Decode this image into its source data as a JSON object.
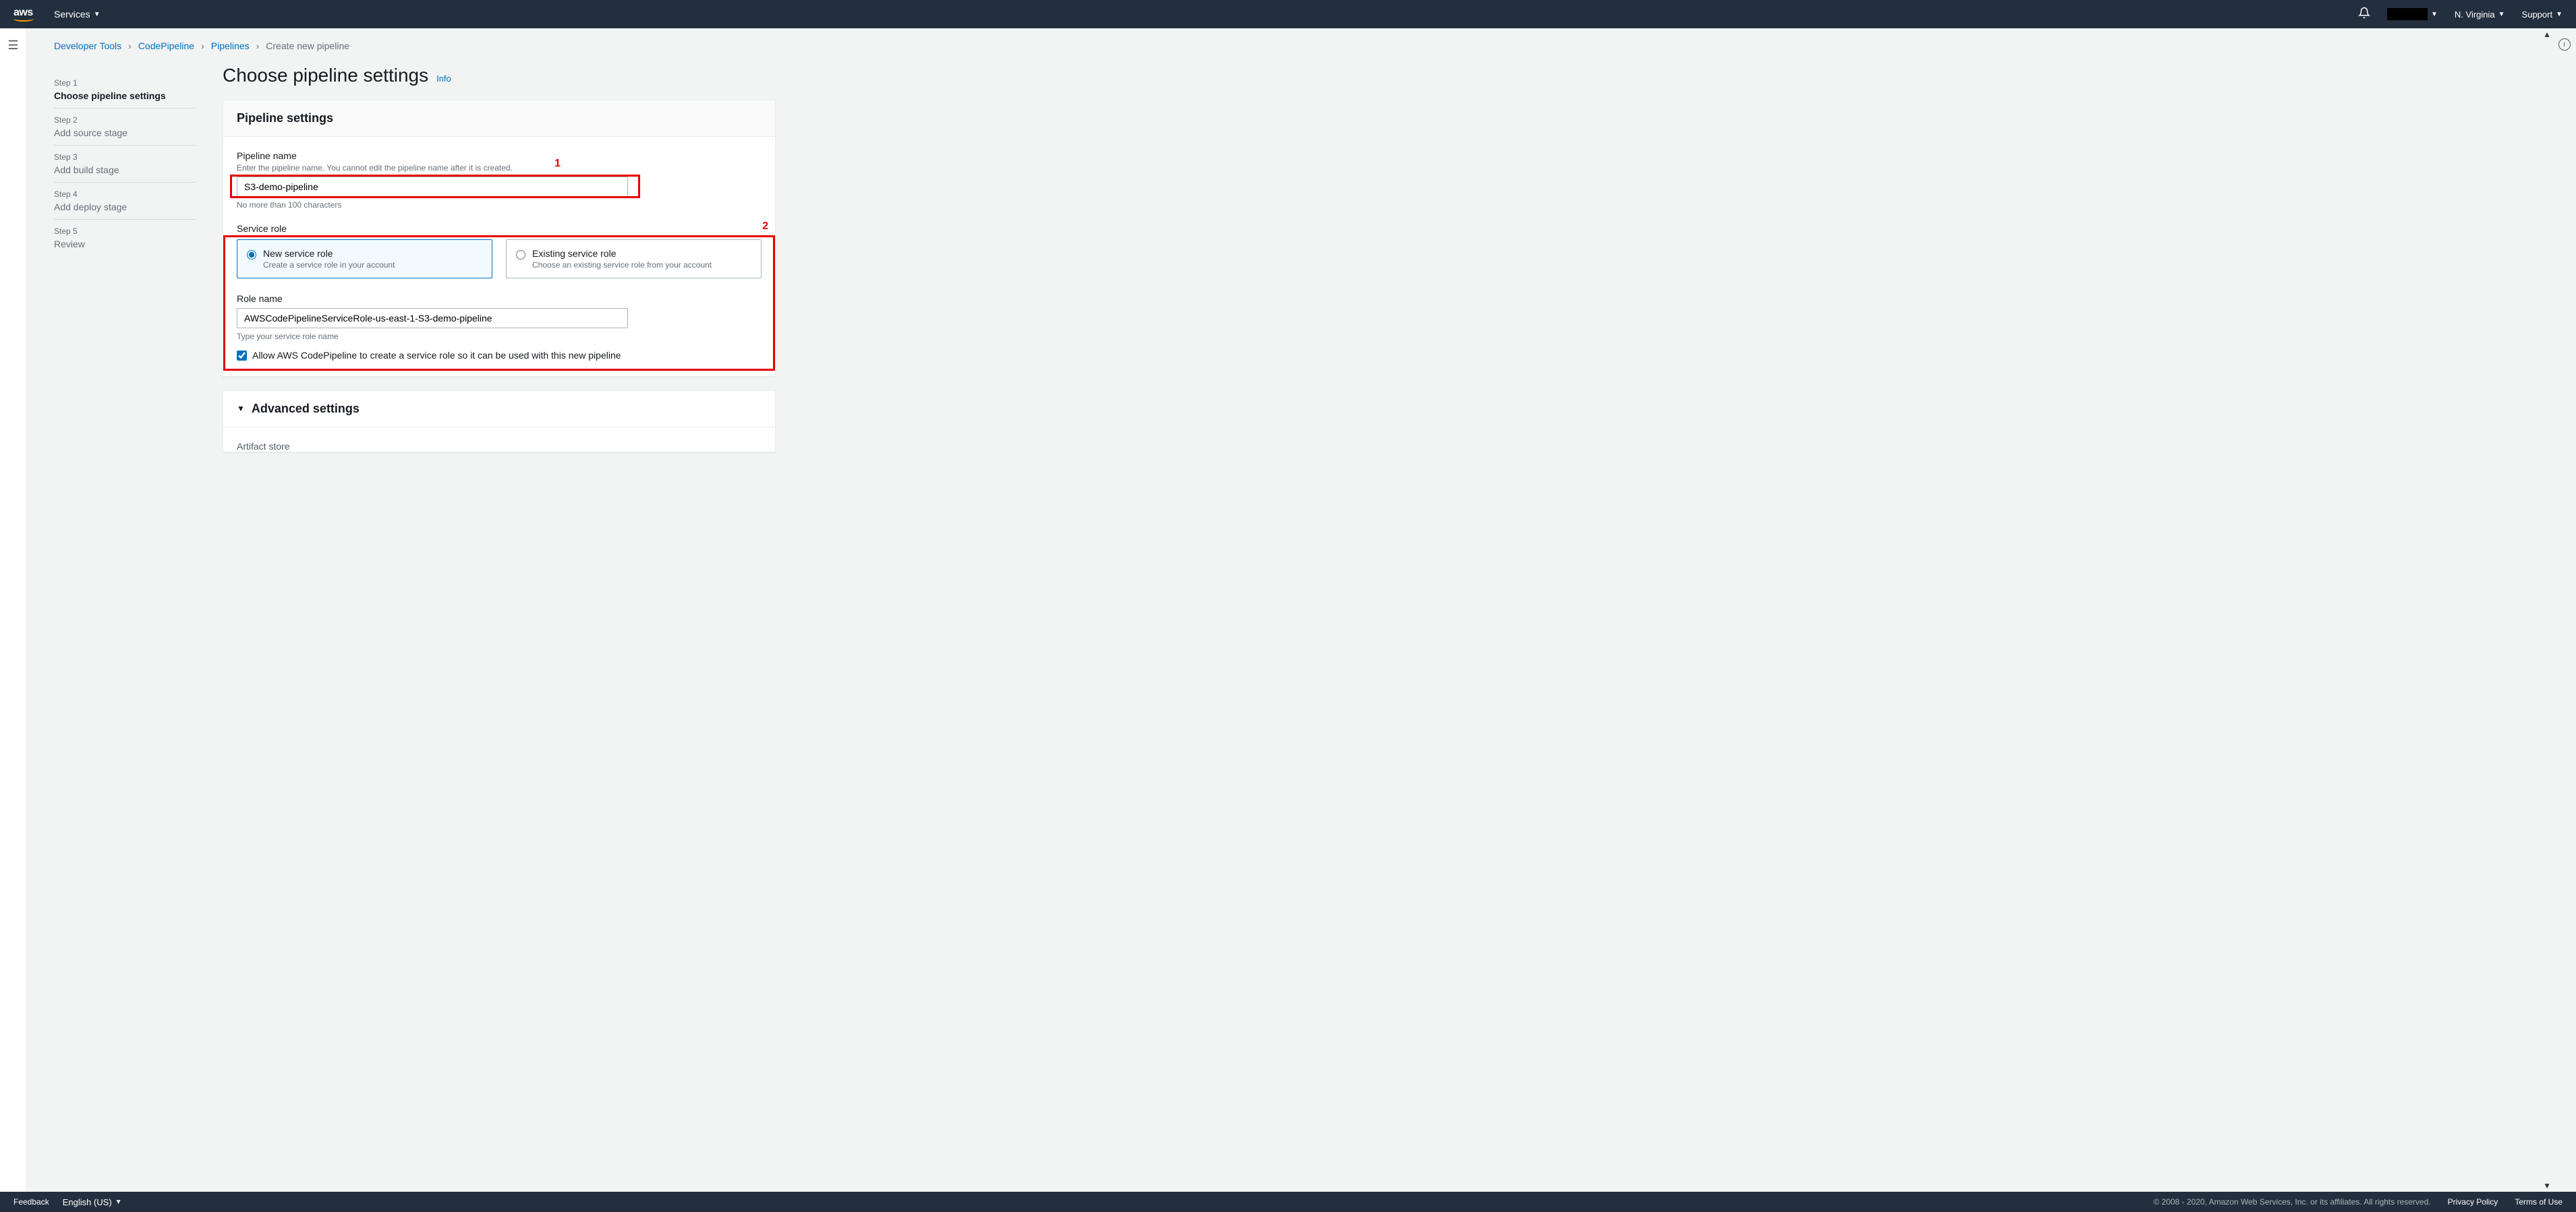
{
  "topnav": {
    "services_label": "Services",
    "region_label": "N. Virginia",
    "support_label": "Support"
  },
  "breadcrumb": {
    "items": [
      {
        "label": "Developer Tools"
      },
      {
        "label": "CodePipeline"
      },
      {
        "label": "Pipelines"
      },
      {
        "label": "Create new pipeline"
      }
    ]
  },
  "wizard": {
    "steps": [
      {
        "num": "Step 1",
        "title": "Choose pipeline settings",
        "active": true
      },
      {
        "num": "Step 2",
        "title": "Add source stage",
        "active": false
      },
      {
        "num": "Step 3",
        "title": "Add build stage",
        "active": false
      },
      {
        "num": "Step 4",
        "title": "Add deploy stage",
        "active": false
      },
      {
        "num": "Step 5",
        "title": "Review",
        "active": false
      }
    ]
  },
  "page": {
    "heading": "Choose pipeline settings",
    "info_link": "Info"
  },
  "pipeline_settings": {
    "panel_title": "Pipeline settings",
    "name_label": "Pipeline name",
    "name_desc": "Enter the pipeline name. You cannot edit the pipeline name after it is created.",
    "name_value": "S3-demo-pipeline",
    "name_hint": "No more than 100 characters",
    "service_role_label": "Service role",
    "new_role_title": "New service role",
    "new_role_desc": "Create a service role in your account",
    "existing_role_title": "Existing service role",
    "existing_role_desc": "Choose an existing service role from your account",
    "role_name_label": "Role name",
    "role_name_value": "AWSCodePipelineServiceRole-us-east-1-S3-demo-pipeline",
    "role_name_hint": "Type your service role name",
    "allow_create_label": "Allow AWS CodePipeline to create a service role so it can be used with this new pipeline"
  },
  "advanced": {
    "title": "Advanced settings",
    "artifact_label": "Artifact store"
  },
  "annotations": {
    "label1": "1",
    "label2": "2"
  },
  "footer": {
    "feedback": "Feedback",
    "language": "English (US)",
    "copyright": "© 2008 - 2020, Amazon Web Services, Inc. or its affiliates. All rights reserved.",
    "privacy": "Privacy Policy",
    "terms": "Terms of Use"
  }
}
